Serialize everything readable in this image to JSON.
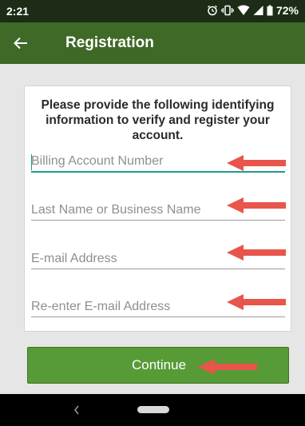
{
  "status_bar": {
    "time": "2:21",
    "battery": "72%",
    "icons": [
      "alarm-icon",
      "vibrate-icon",
      "wifi-icon",
      "signal-icon",
      "battery-icon"
    ]
  },
  "app_bar": {
    "title": "Registration",
    "back_icon": "arrow-left-icon"
  },
  "form": {
    "instructions": "Please provide the following identifying information to verify and register your account.",
    "fields": [
      {
        "placeholder": "Billing Account Number",
        "value": ""
      },
      {
        "placeholder": "Last Name or Business Name",
        "value": ""
      },
      {
        "placeholder": "E-mail Address",
        "value": ""
      },
      {
        "placeholder": "Re-enter E-mail Address",
        "value": ""
      }
    ],
    "continue_label": "Continue"
  },
  "colors": {
    "app_bar": "#3f6927",
    "status_bar": "#1c2c16",
    "button": "#579b37",
    "focus_accent": "#1f9b88",
    "annotation_arrow": "#e8554a"
  }
}
